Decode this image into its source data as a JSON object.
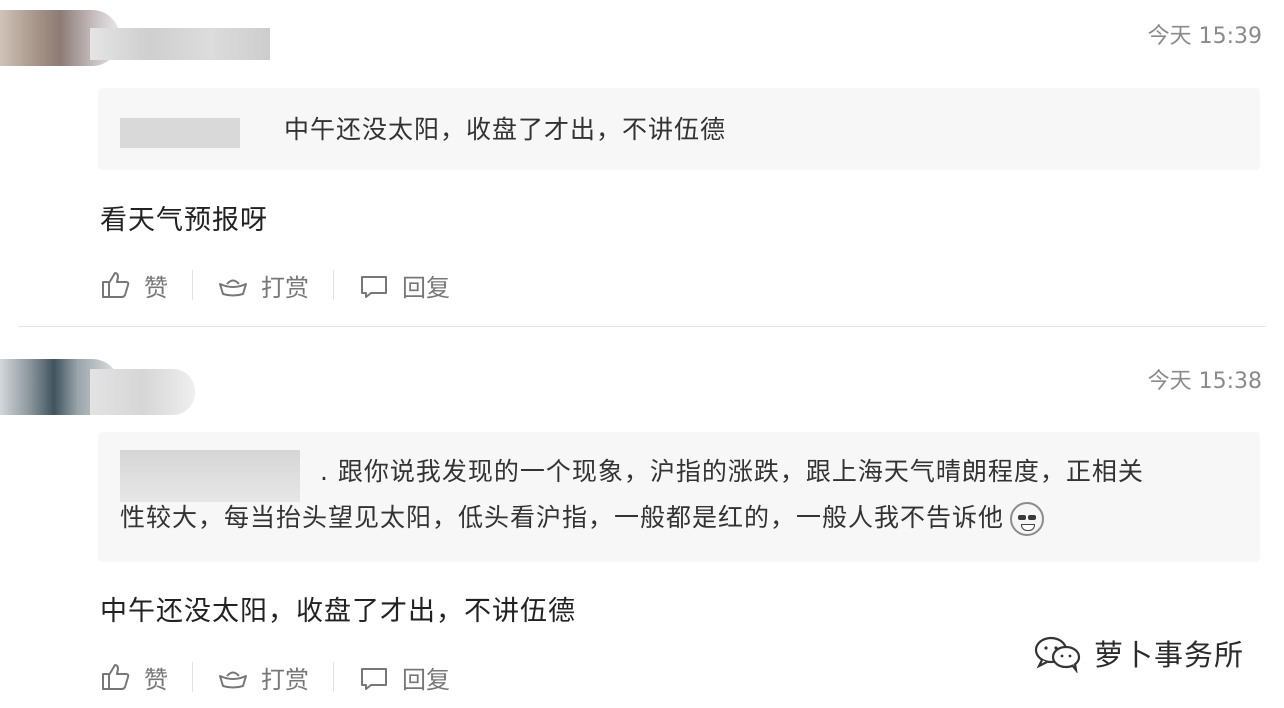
{
  "comments": [
    {
      "time": "今天 15:39",
      "quote_text": "中午还没太阳，收盘了才出，不讲伍德",
      "body": "看天气预报呀",
      "actions": {
        "like": "赞",
        "reward": "打赏",
        "reply": "回复"
      }
    },
    {
      "time": "今天 15:38",
      "quote_line1": ". 跟你说我发现的一个现象，沪指的涨跌，跟上海天气晴朗程度，正相关",
      "quote_line2": "性较大，每当抬头望见太阳，低头看沪指，一般都是红的，一般人我不告诉他",
      "body": "中午还没太阳，收盘了才出，不讲伍德",
      "actions": {
        "like": "赞",
        "reward": "打赏",
        "reply": "回复"
      }
    }
  ],
  "watermark": {
    "text": "萝卜事务所",
    "icon": "wechat-icon"
  },
  "icons": [
    "thumbs-up-icon",
    "ingot-icon",
    "reply-bubble-icon",
    "grin-emoji-icon"
  ],
  "colors": {
    "meta": "#8a8a8a",
    "quote_bg": "#f7f7f7",
    "divider": "#e6e6e6"
  }
}
